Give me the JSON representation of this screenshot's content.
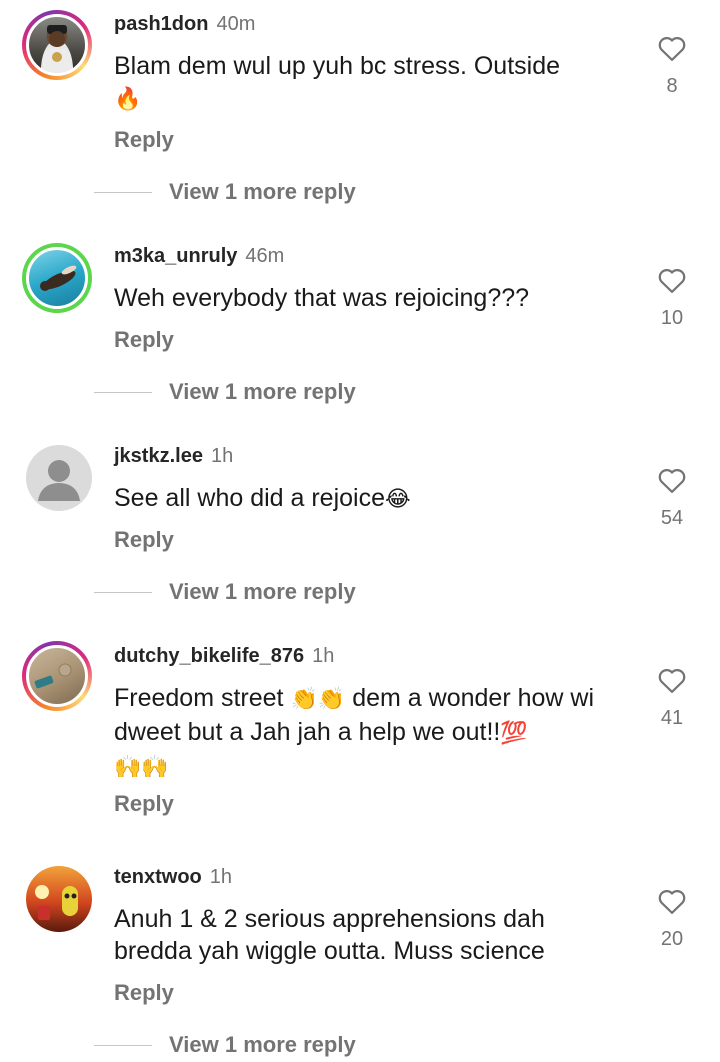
{
  "comments": [
    {
      "username": "pash1don",
      "time": "40m",
      "text": "Blam dem wul up yuh bc stress. Outside",
      "text_emoji": "🔥",
      "reply_label": "Reply",
      "view_more": "View 1 more reply",
      "likes": "8",
      "avatar_ring": "story"
    },
    {
      "username": "m3ka_unruly",
      "time": "46m",
      "text": "Weh everybody that was rejoicing???",
      "reply_label": "Reply",
      "view_more": "View 1 more reply",
      "likes": "10",
      "avatar_ring": "green"
    },
    {
      "username": "jkstkz.lee",
      "time": "1h",
      "text": "See all who did a rejoice",
      "text_emoji": "😂",
      "reply_label": "Reply",
      "view_more": "View 1 more reply",
      "likes": "54",
      "avatar_ring": "none"
    },
    {
      "username": "dutchy_bikelife_876",
      "time": "1h",
      "text_part1": "Freedom street",
      "text_emoji1": "👏👏",
      "text_part2": "dem a wonder how wi dweet but a Jah jah a help we out!!",
      "text_emoji2": "💯",
      "text_emoji3": "🙌🙌",
      "reply_label": "Reply",
      "likes": "41",
      "avatar_ring": "story"
    },
    {
      "username": "tenxtwoo",
      "time": "1h",
      "text": "Anuh 1 & 2 serious apprehensions dah bredda yah wiggle outta. Muss science",
      "reply_label": "Reply",
      "view_more": "View 1 more reply",
      "likes": "20",
      "avatar_ring": "none"
    }
  ],
  "colors": {
    "text": "#262626",
    "muted": "#737373",
    "divider": "#c7c7c7",
    "green_ring": "#5cd64d"
  },
  "icons": {
    "like": "heart-outline-icon",
    "default_avatar": "person-silhouette-icon"
  }
}
